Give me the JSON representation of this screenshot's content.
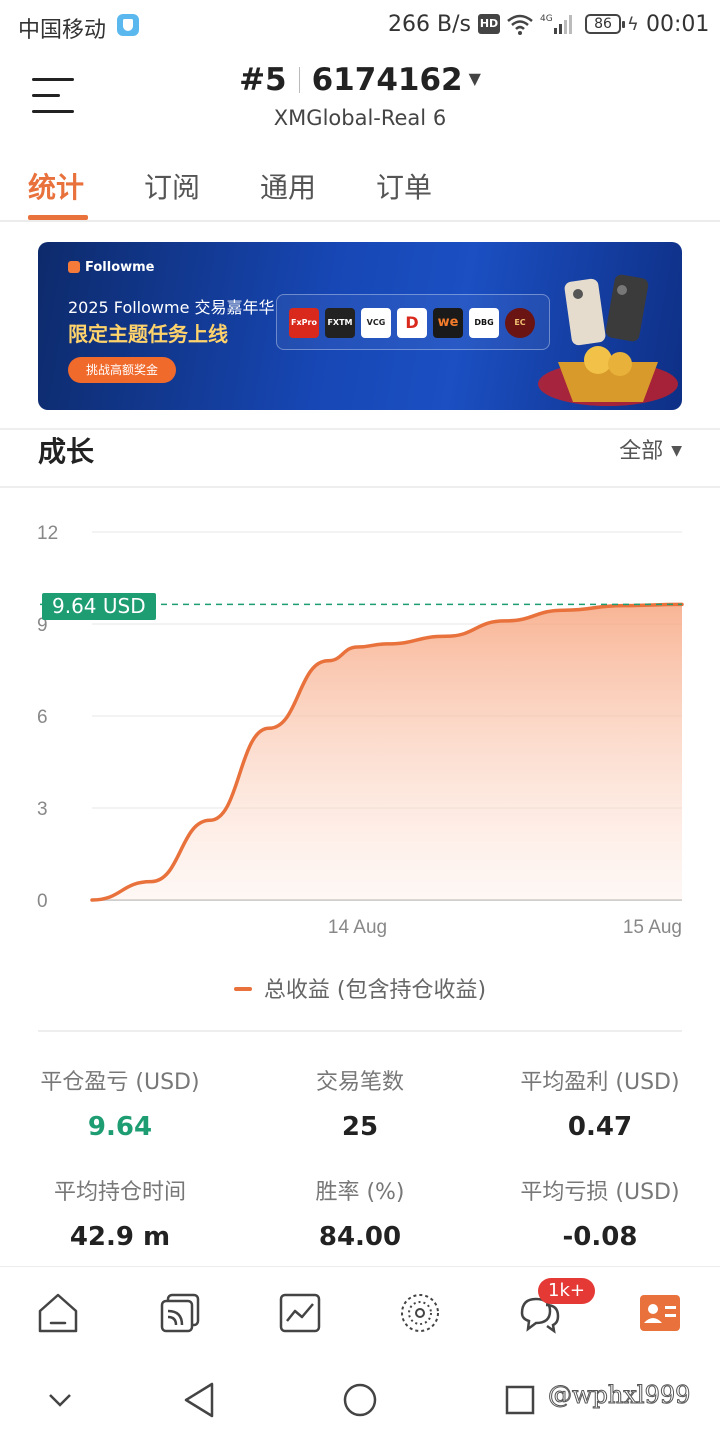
{
  "status_bar": {
    "carrier": "中国移动",
    "net_speed": "266 B/s",
    "hd": "HD",
    "network": "4G",
    "battery": "86",
    "time": "00:01"
  },
  "header": {
    "account_rank": "#5",
    "account_number": "6174162",
    "account_server": "XMGlobal-Real 6"
  },
  "tabs": [
    {
      "label": "统计",
      "active": true
    },
    {
      "label": "订阅",
      "active": false
    },
    {
      "label": "通用",
      "active": false
    },
    {
      "label": "订单",
      "active": false
    }
  ],
  "banner": {
    "brand": "Followme",
    "line1": "2025 Followme 交易嘉年华",
    "line2": "限定主题任务上线",
    "cta": "挑战高额奖金",
    "partner_logos": [
      "FxPro",
      "FXTM",
      "VCG",
      "D",
      "we",
      "DBG",
      "EC"
    ]
  },
  "growth": {
    "title": "成长",
    "filter": "全部",
    "value_badge": "9.64 USD",
    "legend": "总收益 (包含持仓收益)"
  },
  "chart_data": {
    "type": "area",
    "title": "",
    "xlabel": "",
    "ylabel": "",
    "ylim": [
      0,
      12
    ],
    "y_ticks": [
      "0",
      "3",
      "6",
      "9",
      "12"
    ],
    "x_ticks": [
      "14 Aug",
      "15 Aug"
    ],
    "grid": true,
    "legend_position": "bottom",
    "series": [
      {
        "name": "总收益 (包含持仓收益)",
        "color": "#e8713c",
        "x": [
          0.0,
          0.1,
          0.2,
          0.3,
          0.4,
          0.45,
          0.5,
          0.6,
          0.7,
          0.8,
          0.9,
          1.0
        ],
        "y": [
          0.0,
          0.6,
          2.6,
          5.6,
          7.8,
          8.25,
          8.35,
          8.6,
          9.1,
          9.45,
          9.6,
          9.64
        ]
      }
    ],
    "x_tick_positions": [
      0.45,
      1.0
    ],
    "last_value": 9.64
  },
  "stats": [
    {
      "label": "平仓盈亏 (USD)",
      "value": "9.64",
      "color": "green"
    },
    {
      "label": "交易笔数",
      "value": "25",
      "color": "default"
    },
    {
      "label": "平均盈利 (USD)",
      "value": "0.47",
      "color": "default"
    },
    {
      "label": "平均持仓时间",
      "value": "42.9 m",
      "color": "default"
    },
    {
      "label": "胜率 (%)",
      "value": "84.00",
      "color": "default"
    },
    {
      "label": "平均亏损 (USD)",
      "value": "-0.08",
      "color": "default"
    }
  ],
  "bottom_nav": {
    "items": [
      "home-icon",
      "cards-icon",
      "chart-icon",
      "discover-icon",
      "messages-icon",
      "profile-icon"
    ],
    "message_badge": "1k+",
    "active_color": "#e8713c"
  },
  "watermark": "@wphxl999"
}
